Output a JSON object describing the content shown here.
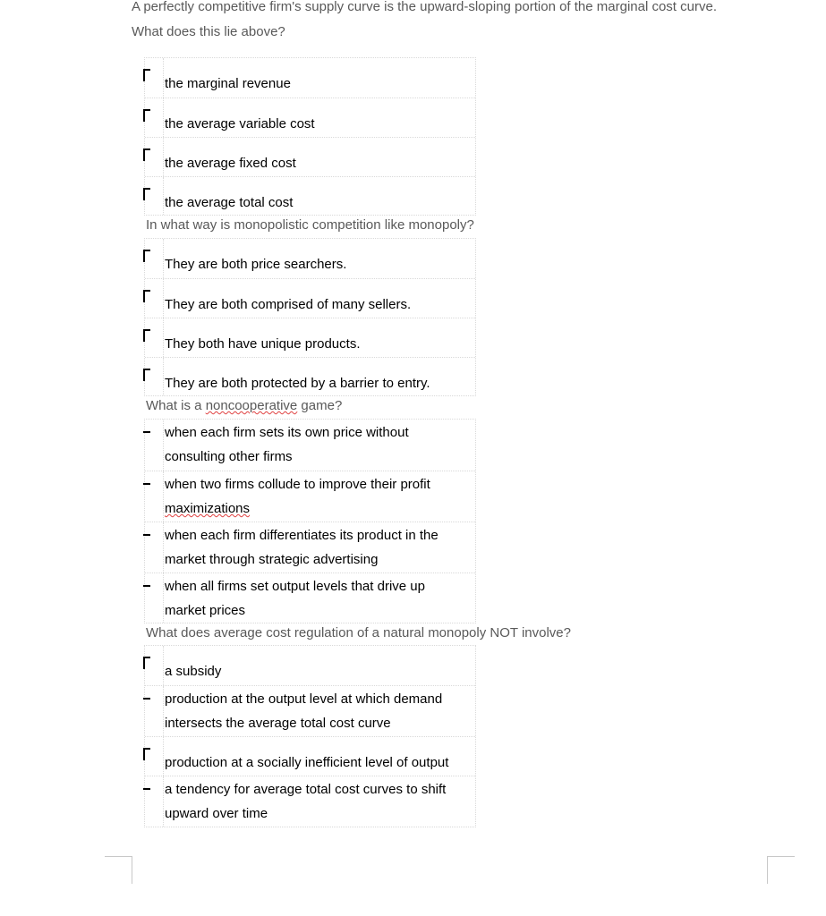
{
  "intro": {
    "line1": "A perfectly competitive firm's supply curve is the upward-sloping portion of the marginal cost curve.",
    "line2": "What does this lie above?"
  },
  "questions": [
    {
      "prompt": "",
      "options": [
        "the marginal revenue",
        "the average variable cost",
        "the average fixed cost",
        "the average total cost"
      ]
    },
    {
      "prompt": "In what way is monopolistic competition like monopoly?",
      "options": [
        "They are both price searchers.",
        "They are both comprised of many sellers.",
        "They both have unique products.",
        "They are both protected by a barrier to entry."
      ]
    },
    {
      "prompt_prefix": "What is a ",
      "prompt_flagged": "noncooperative",
      "prompt_suffix": " game?",
      "options": [
        [
          "when each firm sets its own price without",
          "consulting other firms"
        ],
        [
          "when two firms collude to improve their profit",
          "maximizations"
        ],
        [
          "when each firm differentiates its product in the",
          "market through strategic advertising"
        ],
        [
          "when all firms set output levels that drive up",
          "market prices"
        ]
      ]
    },
    {
      "prompt": "What does average cost regulation of a natural monopoly NOT involve?",
      "options": [
        [
          "a subsidy"
        ],
        [
          "production at the output level at which demand",
          "intersects the average total cost curve"
        ],
        [
          "production at a socially inefficient level of output"
        ],
        [
          "a tendency for average total cost curves to shift",
          "upward over time"
        ]
      ]
    }
  ]
}
